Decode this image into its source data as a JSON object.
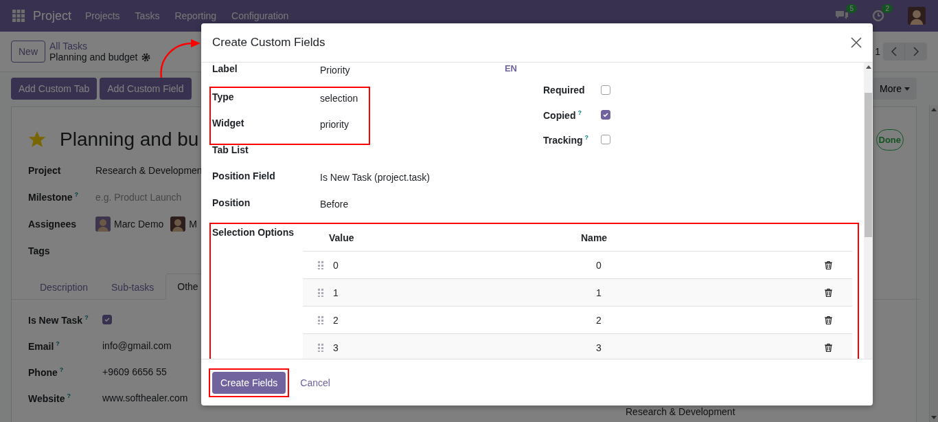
{
  "navbar": {
    "app": "Project",
    "menus": [
      "Projects",
      "Tasks",
      "Reporting",
      "Configuration"
    ],
    "messages_badge": "5",
    "activities_badge": "2"
  },
  "control_panel": {
    "new_button": "New",
    "breadcrumb": "All Tasks",
    "record": "Planning and budget",
    "pager": "1",
    "action_buttons": [
      "Add Custom Tab",
      "Add Custom Field"
    ],
    "more_button": "More"
  },
  "form": {
    "starred": true,
    "title": "Planning and bu",
    "status_button": "Done",
    "fields": [
      {
        "kind": "text",
        "label": "Project",
        "value": "Research & Developmen"
      },
      {
        "kind": "placeholder",
        "label": "Milestone",
        "help": "?",
        "placeholder": "e.g. Product Launch"
      },
      {
        "kind": "avatars",
        "label": "Assignees",
        "assignees": [
          "Marc Demo",
          "M"
        ]
      },
      {
        "kind": "text",
        "label": "Tags"
      }
    ],
    "tabs": [
      {
        "label": "Description",
        "selected": false
      },
      {
        "label": "Sub-tasks",
        "selected": false
      },
      {
        "label": "Othe",
        "selected": true
      }
    ],
    "tab_fields": [
      {
        "kind": "checkbox",
        "label": "Is New Task",
        "help": "?",
        "checked": true
      },
      {
        "kind": "text",
        "label": "Email",
        "help": "?",
        "value": "info@gmail.com"
      },
      {
        "kind": "text",
        "label": "Phone",
        "help": "?",
        "value": "+9609 6656 55"
      },
      {
        "kind": "text",
        "label": "Website",
        "help": "?",
        "value": "www.softhealer.com"
      }
    ],
    "side_value": "Research & Development"
  },
  "dialog": {
    "title": "Create Custom Fields",
    "fields": [
      {
        "label": "Label",
        "value": "Priority",
        "translate": "EN",
        "highlighted": false
      },
      {
        "label": "Type",
        "value": "selection",
        "highlighted": true
      },
      {
        "label": "Widget",
        "value": "priority",
        "highlighted": true
      },
      {
        "label": "Tab List",
        "highlighted": false
      },
      {
        "label": "Position Field",
        "value": "Is New Task (project.task)",
        "highlighted": false
      },
      {
        "label": "Position",
        "value": "Before",
        "highlighted": false
      }
    ],
    "flags": [
      {
        "label": "Required",
        "checked": false
      },
      {
        "label": "Copied",
        "help": "?",
        "checked": true
      },
      {
        "label": "Tracking",
        "help": "?",
        "checked": false
      }
    ],
    "selection_options": {
      "label": "Selection Options",
      "highlighted": true,
      "columns": [
        "Value",
        "Name"
      ],
      "rows": [
        {
          "value": "0",
          "name": "0"
        },
        {
          "value": "1",
          "name": "1"
        },
        {
          "value": "2",
          "name": "2"
        },
        {
          "value": "3",
          "name": "3"
        }
      ]
    },
    "primary_button": {
      "label": "Create Fields",
      "highlighted": true
    },
    "secondary_button": "Cancel"
  }
}
